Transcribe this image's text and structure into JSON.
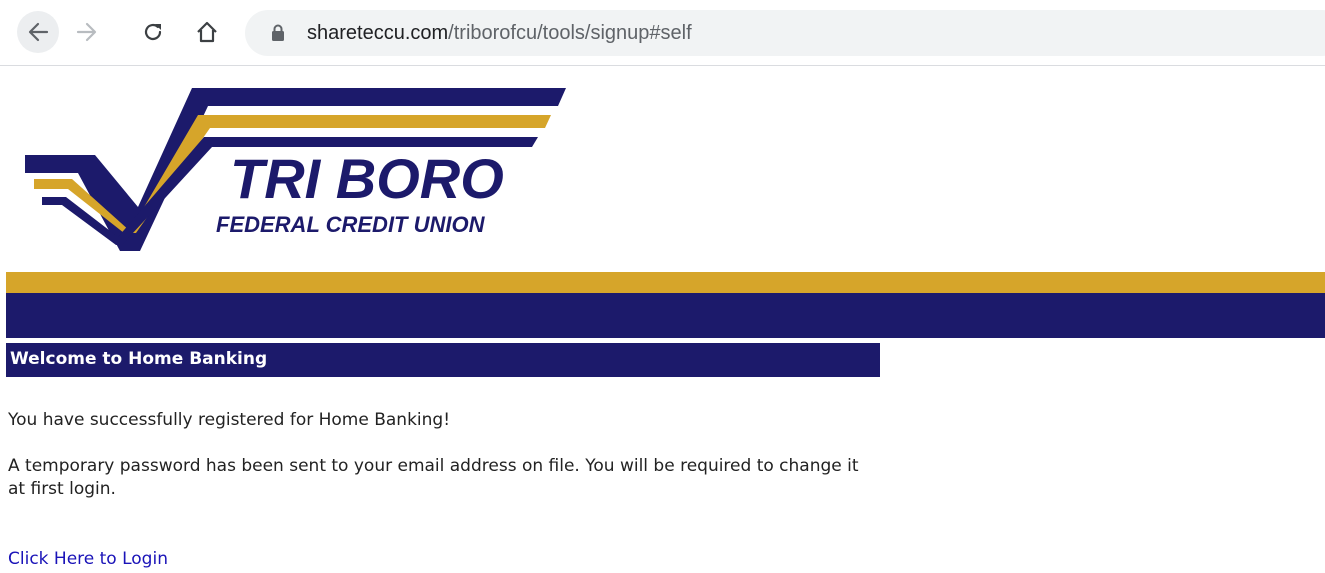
{
  "browser": {
    "url_domain": "shareteccu.com",
    "url_path": "/triborofcu/tools/signup#self"
  },
  "logo": {
    "name_line": "TRI BORO",
    "sub_line": "FEDERAL CREDIT UNION"
  },
  "colors": {
    "gold": "#d6a52a",
    "navy": "#1c1a6b",
    "link": "#1a13b8"
  },
  "content": {
    "heading": "Welcome to Home Banking",
    "success_message": "You have successfully registered for Home Banking!",
    "password_message": "A temporary password has been sent to your email address on file. You will be required to change it at first login.",
    "login_link": "Click Here to Login"
  }
}
